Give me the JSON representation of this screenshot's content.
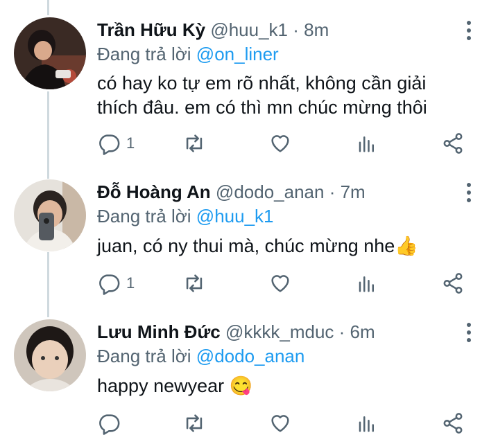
{
  "replies": [
    {
      "name": "Trần Hữu Kỳ",
      "handle": "@huu_k1",
      "time": "· 8m",
      "reply_prefix": "Đang trả lời",
      "reply_to": "@on_liner",
      "text": "có hay ko tự em rõ nhất, không cần giải thích đâu. em có thì mn chúc mừng thôi",
      "reply_count": "1",
      "avatar_icon": "avatar-photo",
      "colors": {
        "accent": "#1d9bf0",
        "muted": "#536471"
      }
    },
    {
      "name": "Đỗ Hoàng An",
      "handle": "@dodo_anan",
      "time": "· 7m",
      "reply_prefix": "Đang trả lời",
      "reply_to": "@huu_k1",
      "text": "juan, có ny thui mà, chúc mừng nhe👍",
      "reply_count": "1",
      "avatar_icon": "avatar-photo"
    },
    {
      "name": "Lưu Minh Đức",
      "handle": "@kkkk_mduc",
      "time": "· 6m",
      "reply_prefix": "Đang trả lời",
      "reply_to": "@dodo_anan",
      "text": "happy newyear 😋",
      "reply_count": "",
      "avatar_icon": "avatar-photo"
    }
  ],
  "icons": [
    "more-vertical-icon",
    "reply-icon",
    "retweet-icon",
    "like-icon",
    "analytics-icon",
    "share-icon"
  ]
}
